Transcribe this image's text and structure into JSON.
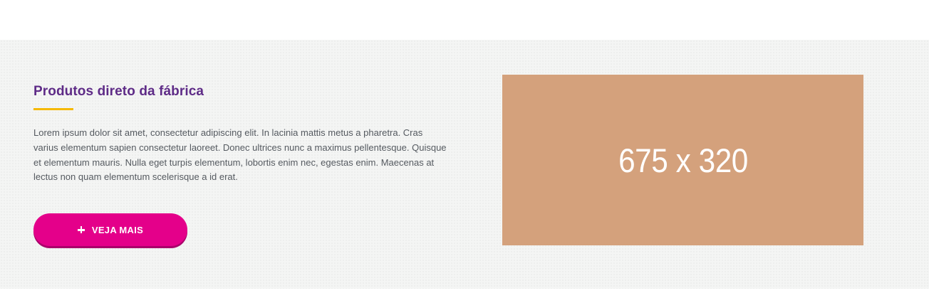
{
  "section": {
    "title": "Produtos direto da fábrica",
    "body": "Lorem ipsum dolor sit amet, consectetur adipiscing elit. In lacinia mattis metus a pharetra. Cras varius elementum sapien consectetur laoreet. Donec ultrices nunc a maximus pellentesque. Quisque et elementum mauris. Nulla eget turpis elementum, lobortis enim nec, egestas enim. Maecenas at lectus non quam elementum scelerisque a id erat.",
    "button": {
      "label": "VEJA MAIS",
      "icon": "plus-icon"
    },
    "image": {
      "placeholder_text": "675 x 320"
    }
  },
  "colors": {
    "title": "#5e2b87",
    "accent_underline": "#f5b800",
    "button": "#e4008a",
    "image_placeholder": "#d4a17c",
    "body_text": "#555a60"
  }
}
